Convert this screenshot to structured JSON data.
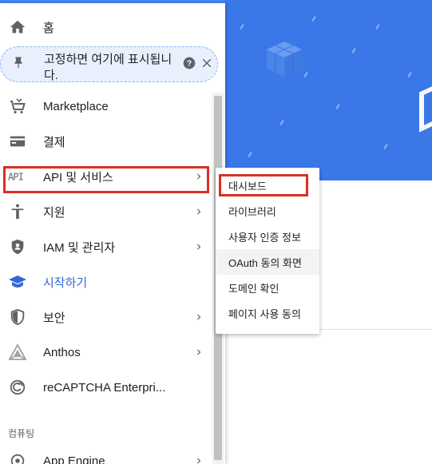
{
  "nav": {
    "home": {
      "label": "홈"
    },
    "pin_hint": {
      "label": "고정하면 여기에 표시됩니다."
    },
    "items": [
      {
        "label": "Marketplace"
      },
      {
        "label": "결제"
      },
      {
        "label": "API 및 서비스"
      },
      {
        "label": "지원"
      },
      {
        "label": "IAM 및 관리자"
      },
      {
        "label": "시작하기"
      },
      {
        "label": "보안"
      },
      {
        "label": "Anthos"
      },
      {
        "label": "reCAPTCHA Enterpri..."
      }
    ],
    "section": "컴퓨팅",
    "partial_item": {
      "label": "App Engine"
    }
  },
  "flyout": {
    "items": [
      {
        "label": "대시보드"
      },
      {
        "label": "라이브러리"
      },
      {
        "label": "사용자 인증 정보"
      },
      {
        "label": "OAuth 동의 화면"
      },
      {
        "label": "도메인 확인"
      },
      {
        "label": "페이지 사용 동의"
      }
    ]
  },
  "icons": [
    "home-icon",
    "pin-icon",
    "help-icon",
    "close-icon",
    "marketplace-cart-icon",
    "billing-icon",
    "api-icon",
    "support-icon",
    "iam-shield-icon",
    "getting-started-icon",
    "security-shield-icon",
    "anthos-icon",
    "recaptcha-icon",
    "app-engine-icon",
    "chevron-right-icon"
  ],
  "colors": {
    "accent": "#3367d6",
    "highlight_box": "#d93025",
    "hero_blue": "#3b78e7"
  }
}
